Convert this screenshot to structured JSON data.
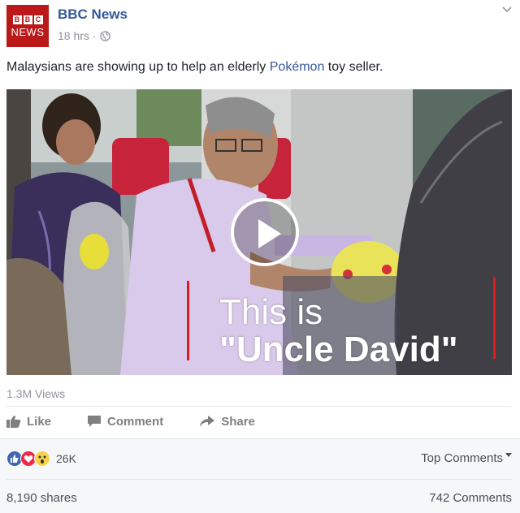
{
  "header": {
    "logo_letters": [
      "B",
      "B",
      "C"
    ],
    "logo_word": "NEWS",
    "page_name": "BBC News",
    "timestamp": "18 hrs",
    "separator": "·",
    "privacy_icon": "globe-icon",
    "menu_icon": "chevron-down-icon"
  },
  "post": {
    "caption_before": "Malaysians are showing up to help an elderly ",
    "caption_link": "Pokémon",
    "caption_after": " toy seller."
  },
  "video": {
    "overlay_line1": "This is",
    "overlay_line2": "\"Uncle David\"",
    "play_icon": "play-icon"
  },
  "stats": {
    "views": "1.3M Views"
  },
  "actions": {
    "like": "Like",
    "comment": "Comment",
    "share": "Share"
  },
  "reactions": {
    "icons": [
      "like-reaction-icon",
      "love-reaction-icon",
      "wow-reaction-icon"
    ],
    "count": "26K",
    "top_comments": "Top Comments",
    "shares": "8,190 shares",
    "comments": "742 Comments"
  },
  "colors": {
    "brand_red": "#bb1919",
    "link_blue": "#365899",
    "like_blue": "#4267b2",
    "love_red": "#f0284a",
    "wow_yellow": "#f7d24a"
  }
}
